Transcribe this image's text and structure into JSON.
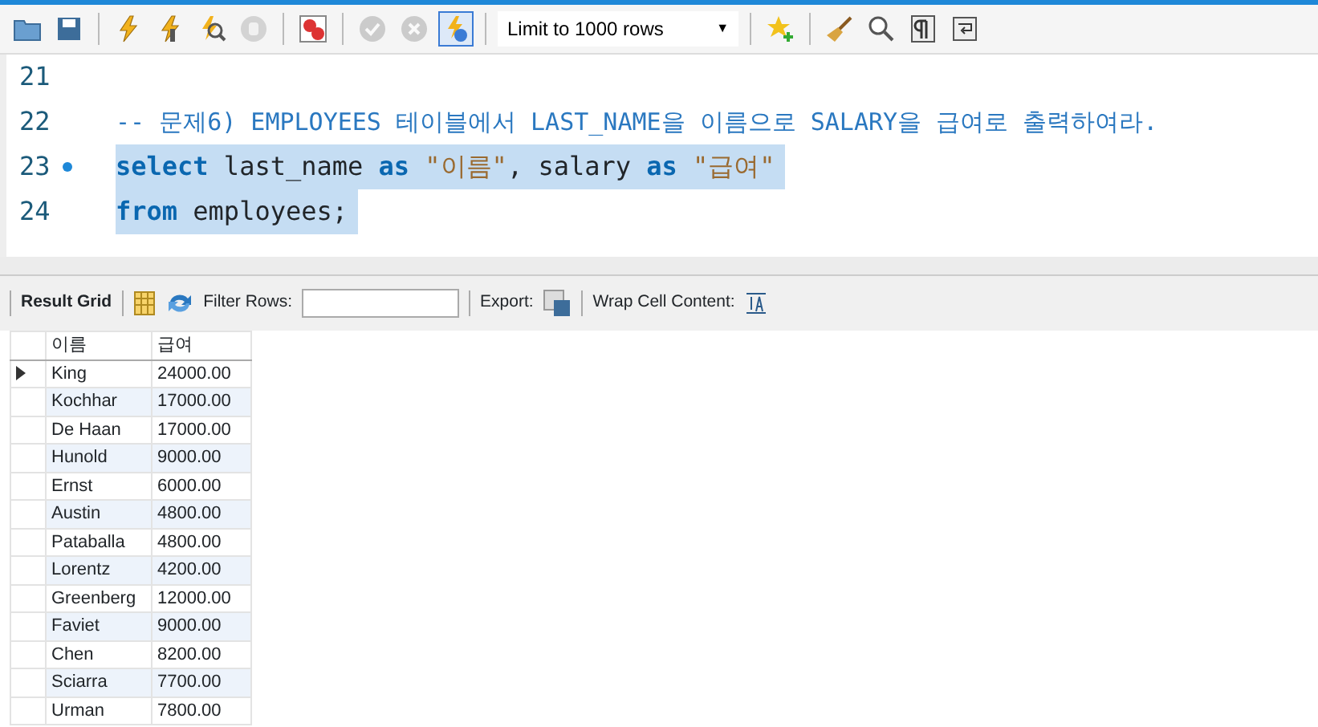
{
  "toolbar": {
    "buttons": [
      {
        "kind": "folder",
        "disabled": false,
        "selected": false
      },
      {
        "kind": "save",
        "disabled": false,
        "selected": false
      },
      {
        "kind": "sep"
      },
      {
        "kind": "bolt",
        "disabled": false,
        "selected": false
      },
      {
        "kind": "bolt-cursor",
        "disabled": false,
        "selected": false
      },
      {
        "kind": "bolt-search",
        "disabled": false,
        "selected": false
      },
      {
        "kind": "hand",
        "disabled": true,
        "selected": false
      },
      {
        "kind": "sep"
      },
      {
        "kind": "stop",
        "disabled": false,
        "selected": false
      },
      {
        "kind": "sep"
      },
      {
        "kind": "check",
        "disabled": true,
        "selected": false
      },
      {
        "kind": "cancel",
        "disabled": true,
        "selected": false
      },
      {
        "kind": "autocommit",
        "disabled": false,
        "selected": true
      },
      {
        "kind": "sep"
      },
      {
        "kind": "limit",
        "label": "Limit to 1000 rows",
        "caret": "▼"
      },
      {
        "kind": "sep"
      },
      {
        "kind": "star",
        "disabled": false,
        "selected": false
      },
      {
        "kind": "sep"
      },
      {
        "kind": "broom",
        "disabled": false,
        "selected": false
      },
      {
        "kind": "magnifier",
        "disabled": false,
        "selected": false
      },
      {
        "kind": "pilcrow",
        "disabled": false,
        "selected": false
      },
      {
        "kind": "wrap",
        "disabled": false,
        "selected": false
      }
    ]
  },
  "editor": {
    "lines": [
      {
        "number": "21",
        "marker": false,
        "selected": false
      },
      {
        "number": "22",
        "marker": false,
        "selected": false,
        "tokens": [
          {
            "kind": "comment",
            "text": "-- 문제6) EMPLOYEES 테이블에서 LAST_NAME을 이름으로 SALARY을 급여로 출력하여라."
          }
        ]
      },
      {
        "number": "23",
        "marker": true,
        "selected": true,
        "tokens": [
          {
            "kind": "keyword",
            "text": "select"
          },
          {
            "kind": "plain",
            "text": " last_name "
          },
          {
            "kind": "keyword",
            "text": "as"
          },
          {
            "kind": "string",
            "text": " \"이름\""
          },
          {
            "kind": "plain",
            "text": ", salary "
          },
          {
            "kind": "keyword",
            "text": "as"
          },
          {
            "kind": "string",
            "text": " \"급여\""
          }
        ]
      },
      {
        "number": "24",
        "marker": false,
        "selected": true,
        "tokens": [
          {
            "kind": "keyword",
            "text": "from"
          },
          {
            "kind": "plain",
            "text": " employees;"
          }
        ]
      }
    ]
  },
  "result_toolbar": {
    "tab": "Result Grid",
    "filter_label": "Filter Rows:",
    "export_label": "Export:",
    "wrap_label": "Wrap Cell Content:"
  },
  "grid": {
    "columns": [
      "이름",
      "급여"
    ],
    "rows": [
      {
        "selected": true,
        "cells": [
          "King",
          "24000.00"
        ]
      },
      {
        "selected": false,
        "cells": [
          "Kochhar",
          "17000.00"
        ]
      },
      {
        "selected": false,
        "cells": [
          "De Haan",
          "17000.00"
        ]
      },
      {
        "selected": false,
        "cells": [
          "Hunold",
          "9000.00"
        ]
      },
      {
        "selected": false,
        "cells": [
          "Ernst",
          "6000.00"
        ]
      },
      {
        "selected": false,
        "cells": [
          "Austin",
          "4800.00"
        ]
      },
      {
        "selected": false,
        "cells": [
          "Pataballa",
          "4800.00"
        ]
      },
      {
        "selected": false,
        "cells": [
          "Lorentz",
          "4200.00"
        ]
      },
      {
        "selected": false,
        "cells": [
          "Greenberg",
          "12000.00"
        ]
      },
      {
        "selected": false,
        "cells": [
          "Faviet",
          "9000.00"
        ]
      },
      {
        "selected": false,
        "cells": [
          "Chen",
          "8200.00"
        ]
      },
      {
        "selected": false,
        "cells": [
          "Sciarra",
          "7700.00"
        ]
      },
      {
        "selected": false,
        "cells": [
          "Urman",
          "7800.00"
        ]
      }
    ]
  }
}
